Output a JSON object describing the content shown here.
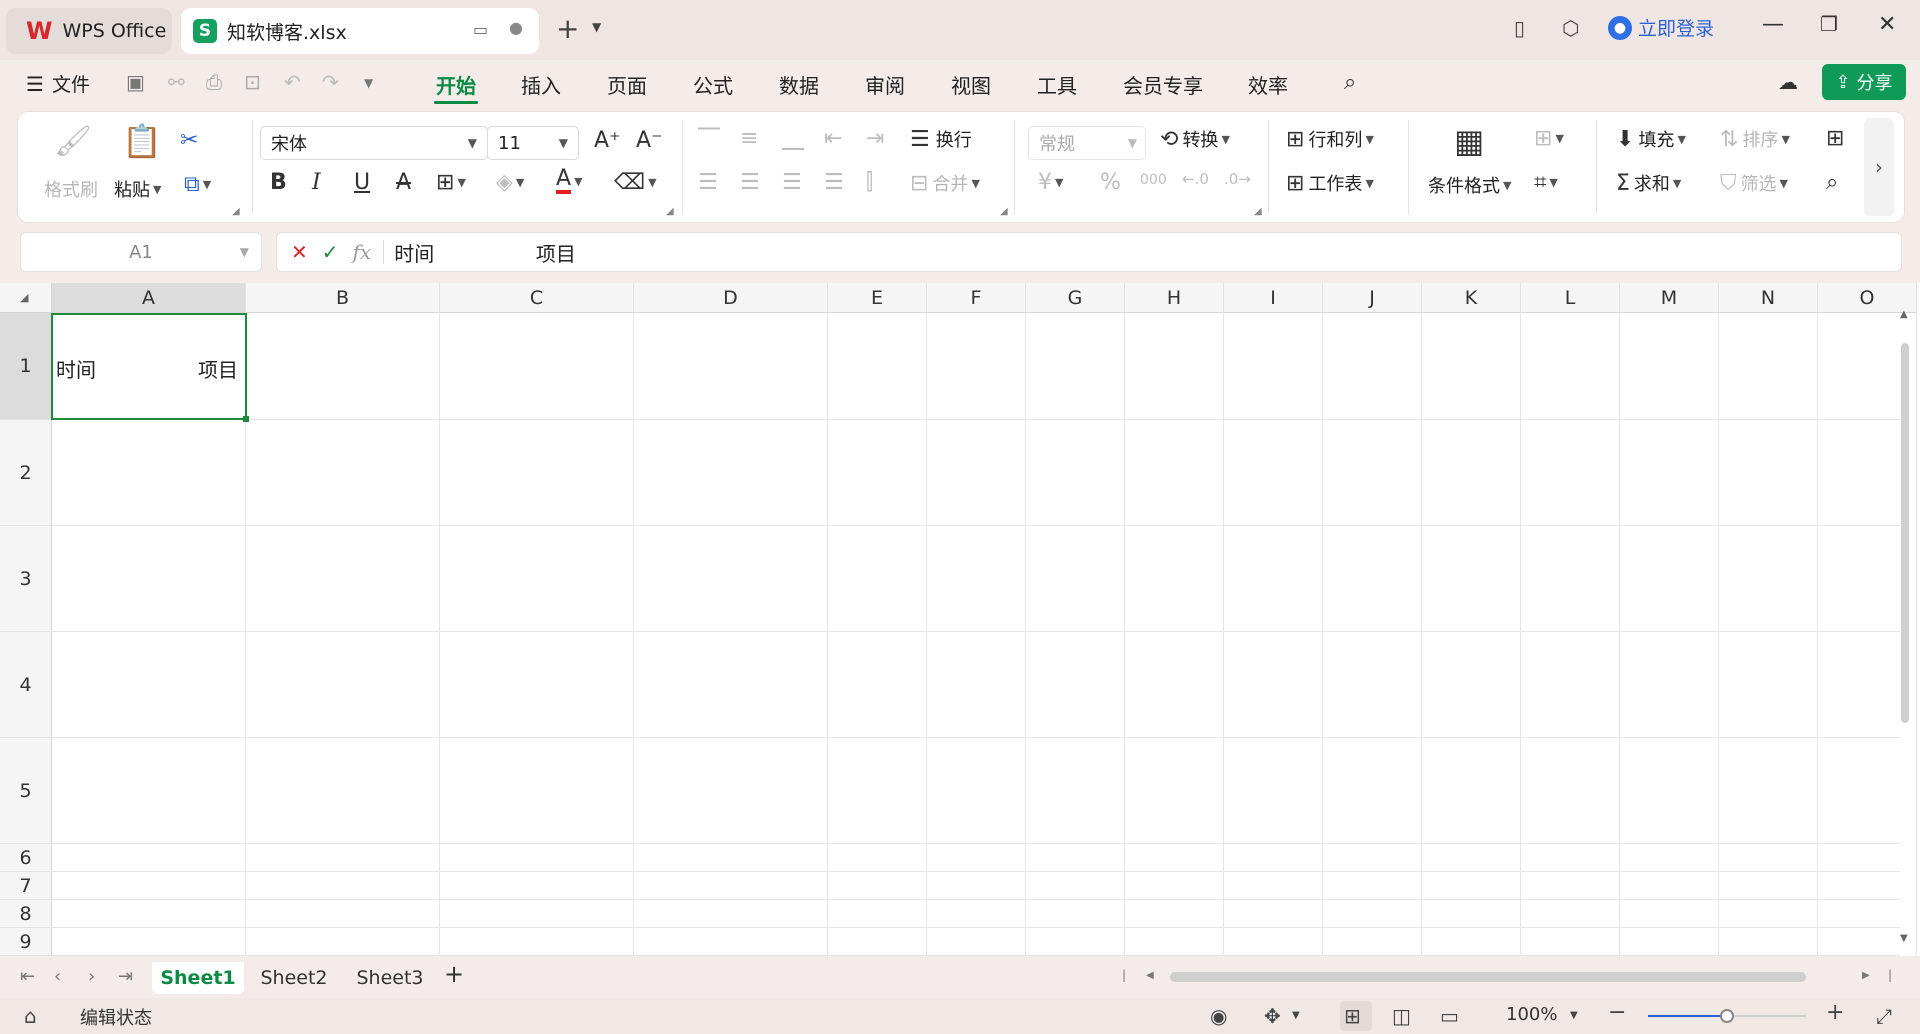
{
  "tabs": {
    "home_label": "WPS Office",
    "home_logo": "W",
    "doc_icon": "S",
    "doc_label": "知软博客.xlsx"
  },
  "account": {
    "login_label": "立即登录"
  },
  "menu": {
    "file_label": "文件",
    "tabs": [
      "开始",
      "插入",
      "页面",
      "公式",
      "数据",
      "审阅",
      "视图",
      "工具",
      "会员专享",
      "效率"
    ],
    "share_label": "分享"
  },
  "ribbon": {
    "format_painter": "格式刷",
    "paste": "粘贴",
    "font_name": "宋体",
    "font_size": "11",
    "wrap": "换行",
    "merge": "合并",
    "number_format": "常规",
    "convert": "转换",
    "row_col": "行和列",
    "worksheet": "工作表",
    "cond_format": "条件格式",
    "fill": "填充",
    "sort": "排序",
    "sum": "求和",
    "filter": "筛选",
    "currency_symbol": "¥",
    "percent_symbol": "%",
    "thousands_symbol": "000"
  },
  "formula": {
    "name_box": "A1",
    "fx_symbol": "fx",
    "content": "时间                项目"
  },
  "grid": {
    "columns": [
      "A",
      "B",
      "C",
      "D",
      "E",
      "F",
      "G",
      "H",
      "I",
      "J",
      "K",
      "L",
      "M",
      "N",
      "O"
    ],
    "rows": [
      "1",
      "2",
      "3",
      "4",
      "5",
      "6",
      "7",
      "8",
      "9"
    ],
    "cell_a1_left": "时间",
    "cell_a1_right": "项目"
  },
  "sheets": {
    "names": [
      "Sheet1",
      "Sheet2",
      "Sheet3"
    ],
    "active": "Sheet1",
    "add_symbol": "+"
  },
  "status": {
    "mode": "编辑状态",
    "zoom": "100%",
    "zoom_level": 0.5
  },
  "colors": {
    "accent_green": "#0b8a45",
    "share_green": "#0f9a58",
    "login_blue": "#2b62d6"
  }
}
